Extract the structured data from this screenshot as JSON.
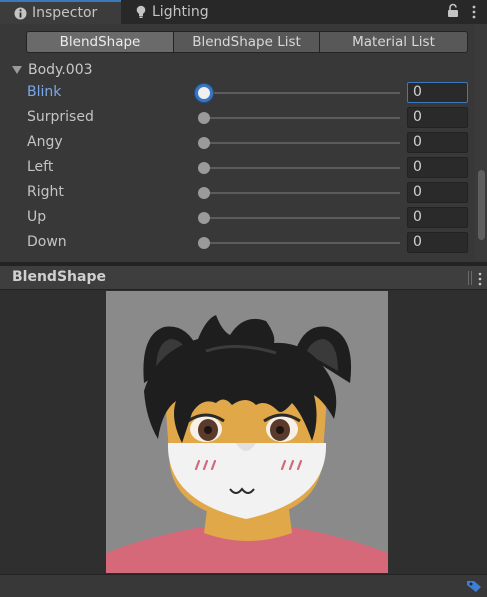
{
  "tabs": [
    {
      "label": "Inspector",
      "icon": "info-icon",
      "active": true
    },
    {
      "label": "Lighting",
      "icon": "lightbulb-icon",
      "active": false
    }
  ],
  "toolbar": {
    "buttons": [
      "BlendShape",
      "BlendShape List",
      "Material List"
    ],
    "selected": "BlendShape"
  },
  "foldout": {
    "label": "Body.003",
    "expanded": true
  },
  "blendshapes": [
    {
      "label": "Blink",
      "value": "0",
      "focused": true
    },
    {
      "label": "Surprised",
      "value": "0"
    },
    {
      "label": "Angy",
      "value": "0"
    },
    {
      "label": "Left",
      "value": "0"
    },
    {
      "label": "Right",
      "value": "0"
    },
    {
      "label": "Up",
      "value": "0"
    },
    {
      "label": "Down",
      "value": "0"
    }
  ],
  "preview": {
    "title": "BlendShape"
  },
  "colors": {
    "accent": "#3a79bb",
    "highlight_label": "#7ba7ea",
    "panel": "#383838",
    "preview_bg": "#8a8a8a",
    "skin": "#e0a848",
    "shirt": "#d5697a"
  }
}
